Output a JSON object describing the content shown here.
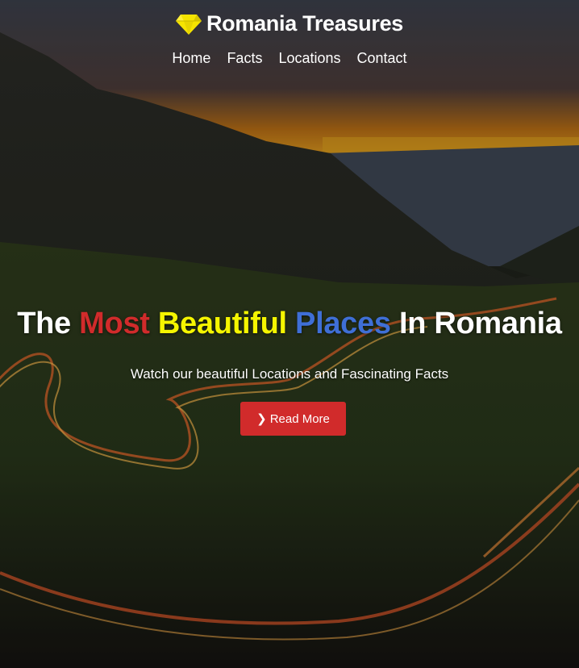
{
  "brand": {
    "name": "Romania Treasures",
    "icon": "diamond-icon",
    "icon_color": "#f5e400"
  },
  "nav": {
    "items": [
      "Home",
      "Facts",
      "Locations",
      "Contact"
    ]
  },
  "hero": {
    "headline": [
      {
        "text": "The",
        "color": "#ffffff"
      },
      {
        "text": "Most",
        "color": "#d12b2b"
      },
      {
        "text": "Beautiful",
        "color": "#f5f500"
      },
      {
        "text": "Places",
        "color": "#3f6fd6"
      },
      {
        "text": "In",
        "color": "#ffffff"
      },
      {
        "text": "Romania",
        "color": "#ffffff"
      }
    ],
    "subtitle": "Watch our beautiful Locations and Fascinating Facts",
    "button_label": "Read More",
    "button_icon": "chevron-right-icon",
    "button_color": "#d12b2b"
  }
}
